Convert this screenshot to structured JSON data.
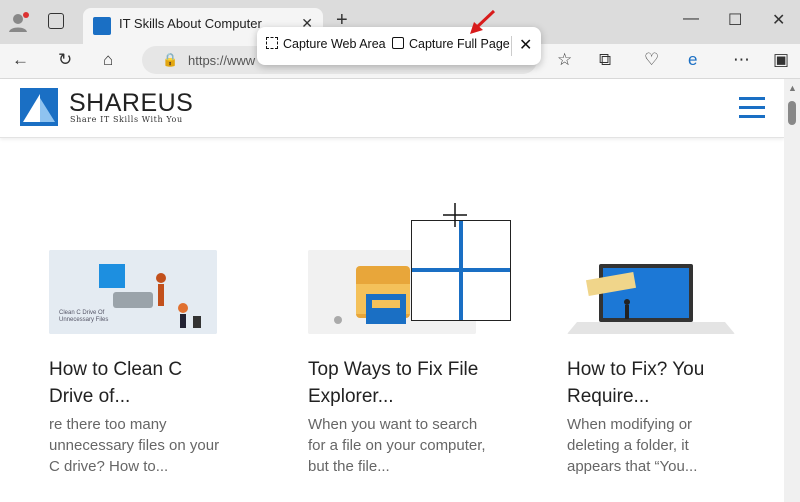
{
  "browser": {
    "tab_title": "IT Skills About Computer",
    "tab_close": "✕",
    "new_tab": "+",
    "minimize": "—",
    "maximize": "☐",
    "close": "✕",
    "address_text": "https://www",
    "capture": {
      "web_area_label": "Capture Web Area",
      "full_page_label": "Capture Full Page",
      "close": "✕"
    }
  },
  "site": {
    "name": "SHAREUS",
    "tagline": "Share IT Skills With You",
    "brand_color": "#1a6fc4"
  },
  "articles": [
    {
      "title": "How to Clean C Drive of...",
      "excerpt": "re there too many unnecessary files on your C drive? How to...",
      "thumb_caption": "Clean C Drive Of Unnecessary Files"
    },
    {
      "title": "Top Ways to Fix File Explorer...",
      "excerpt": "When you want to search for a file on your computer, but the file..."
    },
    {
      "title": "How to Fix? You Require...",
      "excerpt": "When modifying or deleting a folder, it appears that “You..."
    }
  ]
}
